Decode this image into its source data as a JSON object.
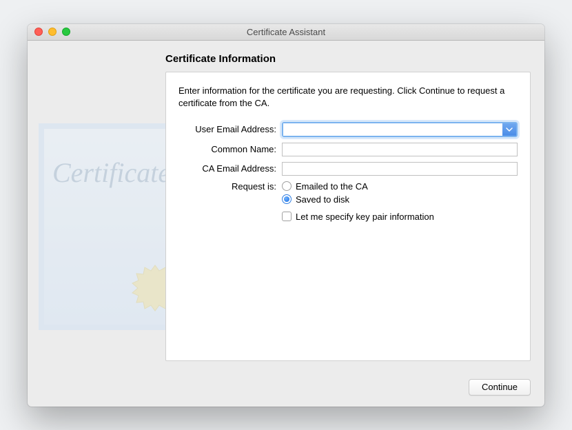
{
  "titlebar": {
    "title": "Certificate Assistant"
  },
  "section": {
    "title": "Certificate Information"
  },
  "instructions": "Enter information for the certificate you are requesting. Click Continue to request a certificate from the CA.",
  "form": {
    "user_email_label": "User Email Address:",
    "user_email_value": "",
    "common_name_label": "Common Name:",
    "common_name_value": "",
    "ca_email_label": "CA Email Address:",
    "ca_email_value": "",
    "request_is_label": "Request is:",
    "radio_emailed": "Emailed to the CA",
    "radio_saved": "Saved to disk",
    "radio_selected": "saved",
    "checkbox_label": "Let me specify key pair information"
  },
  "footer": {
    "continue_label": "Continue"
  },
  "decorative": {
    "script_text": "Certificate"
  }
}
